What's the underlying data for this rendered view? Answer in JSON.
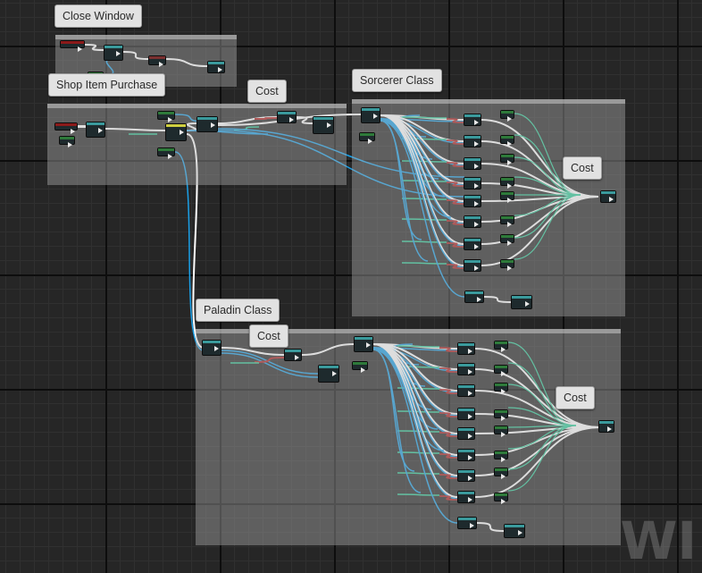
{
  "graph": {
    "comment_titles": {
      "close_window": "Close Window",
      "shop_item_purchase": "Shop Item Purchase",
      "sorcerer_class": "Sorcerer Class",
      "paladin_class": "Paladin Class"
    },
    "cost_labels": [
      "Cost",
      "Cost",
      "Cost",
      "Cost"
    ]
  },
  "watermark": "WI",
  "colors": {
    "background": "#262626",
    "exec_wire": "#ffffff",
    "data_wire": "#1aa0e8",
    "int_wire": "#2ecf9a",
    "bool_wire": "#b21e1e",
    "node_header_event": "#8b1a1a",
    "node_header_function": "#3a9a9c",
    "node_header_pure": "#2e7a3a",
    "comment_body": "#afafaf"
  }
}
